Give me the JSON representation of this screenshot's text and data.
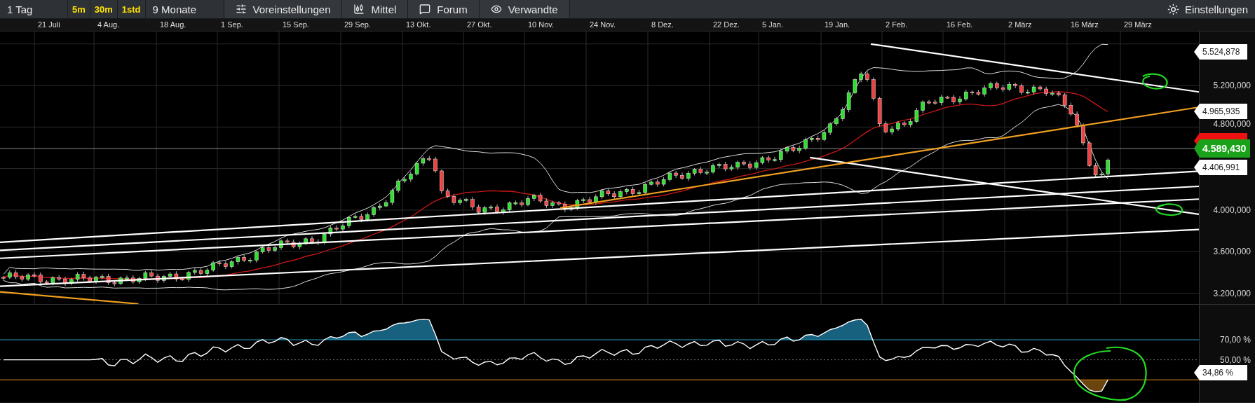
{
  "toolbar": {
    "period": "1 Tag",
    "intervals": [
      {
        "label": "5m"
      },
      {
        "label": "30m"
      },
      {
        "label": "1std"
      }
    ],
    "range": "9 Monate",
    "buttons": [
      {
        "kind": "presets",
        "label": "Voreinstellungen"
      },
      {
        "kind": "indicators",
        "label": "Mittel"
      },
      {
        "kind": "forum",
        "label": "Forum"
      },
      {
        "kind": "related",
        "label": "Verwandte"
      }
    ],
    "settings": "Einstellungen"
  },
  "date_axis": [
    "21 Juli",
    "4 Aug.",
    "18 Aug.",
    "1 Sep.",
    "15 Sep.",
    "29 Sep.",
    "13 Okt.",
    "27 Okt.",
    "10 Nov.",
    "24 Nov.",
    "8 Dez.",
    "22 Dez.",
    "5 Jan.",
    "19 Jan.",
    "2 Feb.",
    "16 Feb.",
    "2 März",
    "16 März",
    "29 März"
  ],
  "price_axis": {
    "ticks": [
      "5.200,000",
      "4.800,000",
      "4.000,000",
      "3.600,000",
      "3.200,000"
    ],
    "markers": [
      {
        "kind": "label",
        "value": "5.524,878"
      },
      {
        "kind": "label",
        "value": "4.965,935"
      },
      {
        "kind": "covered"
      },
      {
        "kind": "last",
        "value": "4.589,430"
      },
      {
        "kind": "label",
        "value": "4.406,991"
      }
    ]
  },
  "rsi_axis": {
    "ticks": [
      "70,00 %",
      "50,00 %"
    ],
    "marker": "34,86 %"
  }
}
